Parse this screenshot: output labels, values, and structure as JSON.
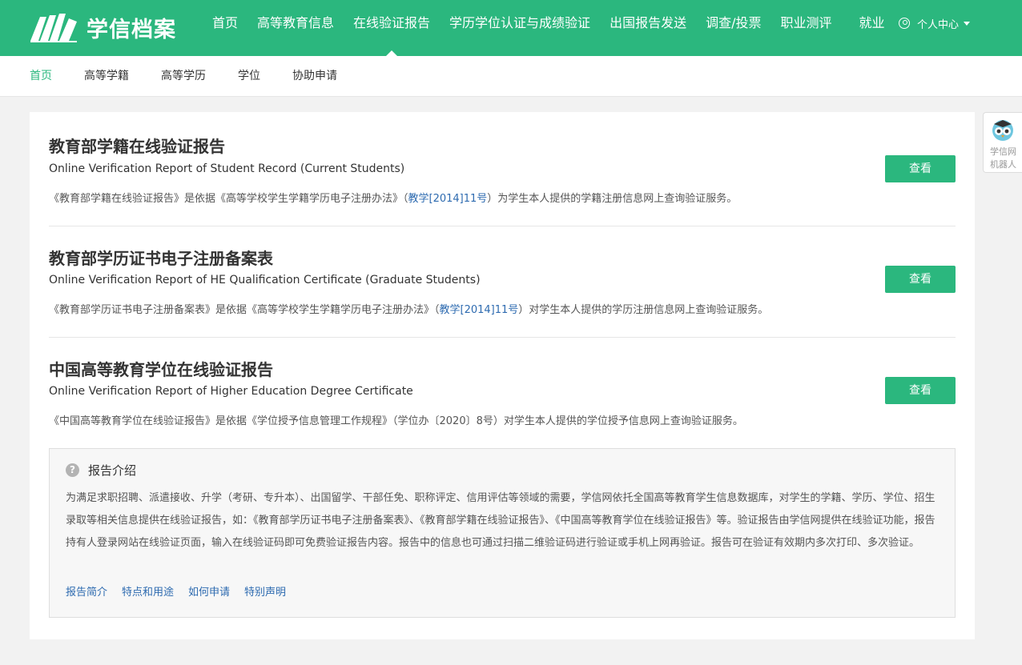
{
  "brand": {
    "name": "学信档案"
  },
  "nav": {
    "items": [
      {
        "label": "首页"
      },
      {
        "label": "高等教育信息"
      },
      {
        "label": "在线验证报告"
      },
      {
        "label": "学历学位认证与成绩验证"
      },
      {
        "label": "出国报告发送"
      },
      {
        "label": "调查/投票"
      },
      {
        "label": "职业测评"
      },
      {
        "label": "就业"
      }
    ],
    "active_label": "在线验证报告",
    "user_center": "个人中心"
  },
  "subnav": {
    "items": [
      {
        "label": "首页"
      },
      {
        "label": "高等学籍"
      },
      {
        "label": "高等学历"
      },
      {
        "label": "学位"
      },
      {
        "label": "协助申请"
      }
    ],
    "active_label": "首页"
  },
  "reports": [
    {
      "title": "教育部学籍在线验证报告",
      "subtitle": "Online Verification Report of Student Record (Current Students)",
      "desc_before": "《教育部学籍在线验证报告》是依据《高等学校学生学籍学历电子注册办法》（",
      "desc_link": "教学[2014]11号",
      "desc_after": "）为学生本人提供的学籍注册信息网上查询验证服务。",
      "button": "查看"
    },
    {
      "title": "教育部学历证书电子注册备案表",
      "subtitle": "Online Verification Report of HE Qualification Certificate (Graduate Students)",
      "desc_before": "《教育部学历证书电子注册备案表》是依据《高等学校学生学籍学历电子注册办法》（",
      "desc_link": "教学[2014]11号",
      "desc_after": "）对学生本人提供的学历注册信息网上查询验证服务。",
      "button": "查看"
    },
    {
      "title": "中国高等教育学位在线验证报告",
      "subtitle": "Online Verification Report of Higher Education Degree Certificate",
      "desc_before": "《中国高等教育学位在线验证报告》是依据《学位授予信息管理工作规程》（学位办〔2020〕8号）对学生本人提供的学位授予信息网上查询验证服务。",
      "desc_link": "",
      "desc_after": "",
      "button": "查看"
    }
  ],
  "intro": {
    "icon": "question-circle-icon",
    "title": "报告介绍",
    "body": "为满足求职招聘、派遣接收、升学（考研、专升本）、出国留学、干部任免、职称评定、信用评估等领域的需要，学信网依托全国高等教育学生信息数据库，对学生的学籍、学历、学位、招生录取等相关信息提供在线验证报告，如：《教育部学历证书电子注册备案表》、《教育部学籍在线验证报告》、《中国高等教育学位在线验证报告》等。验证报告由学信网提供在线验证功能，报告持有人登录网站在线验证页面，输入在线验证码即可免费验证报告内容。报告中的信息也可通过扫描二维验证码进行验证或手机上网再验证。报告可在验证有效期内多次打印、多次验证。",
    "links": [
      "报告简介",
      "特点和用途",
      "如何申请",
      "特别声明"
    ]
  },
  "robot": {
    "line1": "学信网",
    "line2": "机器人"
  },
  "colors": {
    "brand_green": "#2bb77e",
    "link_blue": "#2e6bb0"
  }
}
